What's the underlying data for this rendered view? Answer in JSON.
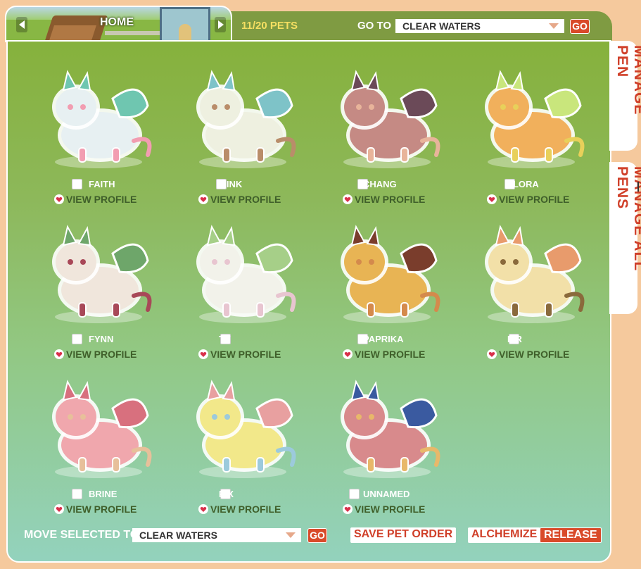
{
  "header": {
    "home_label": "HOME",
    "pet_count": "11/20 PETS",
    "goto_label": "GO TO",
    "goto_selected": "CLEAR WATERS",
    "go_button": "GO"
  },
  "side_tabs": {
    "manage_pen": "MANAGE PEN",
    "manage_all_pens": "MANAGE ALL PENS"
  },
  "pets": [
    {
      "name": "FAITH",
      "view_label": "VIEW PROFILE",
      "colors": [
        "#e7f0f2",
        "#6fc6b0",
        "#f29db1"
      ]
    },
    {
      "name": "MINK",
      "view_label": "VIEW PROFILE",
      "colors": [
        "#eef0e0",
        "#7ec3c8",
        "#b98d6a"
      ]
    },
    {
      "name": "CHANG",
      "view_label": "VIEW PROFILE",
      "colors": [
        "#c58a84",
        "#6b4a58",
        "#e8b49a"
      ]
    },
    {
      "name": "FLORA",
      "view_label": "VIEW PROFILE",
      "colors": [
        "#f1b05c",
        "#c9e67c",
        "#e8d05a"
      ]
    },
    {
      "name": "FYNN",
      "view_label": "VIEW PROFILE",
      "colors": [
        "#f0e6dc",
        "#6ea66a",
        "#a84858"
      ]
    },
    {
      "name": "TY",
      "view_label": "VIEW PROFILE",
      "colors": [
        "#f2f2ea",
        "#a6cf88",
        "#e8c5d0"
      ]
    },
    {
      "name": "PAPRIKA",
      "view_label": "VIEW PROFILE",
      "colors": [
        "#e8b454",
        "#7a3d2c",
        "#d48a4c"
      ]
    },
    {
      "name": "FIR",
      "view_label": "VIEW PROFILE",
      "colors": [
        "#f2e0a8",
        "#e89b6c",
        "#8a6a3c"
      ]
    },
    {
      "name": "BRINE",
      "view_label": "VIEW PROFILE",
      "colors": [
        "#f0a7ad",
        "#d8707e",
        "#e7c09a"
      ]
    },
    {
      "name": "PIX",
      "view_label": "VIEW PROFILE",
      "colors": [
        "#f2e88a",
        "#e8a0a0",
        "#9ccadc"
      ]
    },
    {
      "name": "UNNAMED",
      "view_label": "VIEW PROFILE",
      "colors": [
        "#d88a8c",
        "#3a5aa0",
        "#e8b86a"
      ]
    }
  ],
  "footer": {
    "move_label": "MOVE SELECTED TO",
    "move_selected": "CLEAR WATERS",
    "go_button": "GO",
    "save_order": "SAVE PET ORDER",
    "alchemize": "ALCHEMIZE",
    "release": "RELEASE"
  },
  "colors": {
    "accent_red": "#d94a2a",
    "count_yellow": "#f5df62",
    "header_green": "#7f9b42",
    "page_bg": "#f5c99d"
  }
}
